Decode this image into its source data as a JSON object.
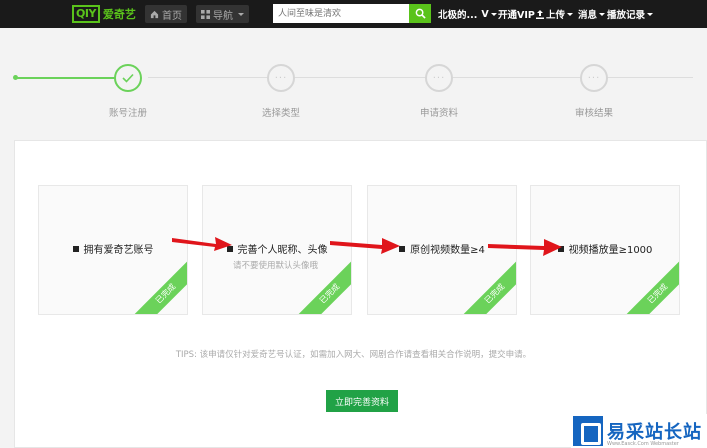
{
  "header": {
    "logo_mark": "QIY",
    "logo_text": "爱奇艺",
    "home_label": "首页",
    "nav_label": "导航",
    "search_placeholder": "人间至味是清欢",
    "user_name": "北极的...",
    "vip_label": "开通VIP",
    "upload_label": "上传",
    "message_label": "消息",
    "history_label": "播放记录"
  },
  "steps": [
    {
      "label": "账号注册",
      "status": "done"
    },
    {
      "label": "选择类型",
      "status": "pending"
    },
    {
      "label": "申请资料",
      "status": "pending"
    },
    {
      "label": "审核结果",
      "status": "pending"
    }
  ],
  "cards": [
    {
      "text": "拥有爱奇艺账号",
      "sub": "",
      "badge": "已完成"
    },
    {
      "text": "完善个人昵称、头像",
      "sub": "请不要使用默认头像哦",
      "badge": "已完成"
    },
    {
      "text": "原创视频数量≥4",
      "sub": "",
      "badge": "已完成"
    },
    {
      "text": "视频播放量≥1000",
      "sub": "",
      "badge": "已完成"
    }
  ],
  "tips": "TIPS: 该申请仅针对爱奇艺号认证，如需加入网大、网剧合作请查看相关合作说明，提交申请。",
  "submit_label": "立即完善资料",
  "watermark": {
    "title": "易采站长站",
    "url": "Www.Easck.Com Webmaster"
  },
  "colors": {
    "accent": "#6bd25a",
    "brand": "#5ac31b",
    "button": "#21a246",
    "arrow": "#e0151b"
  }
}
